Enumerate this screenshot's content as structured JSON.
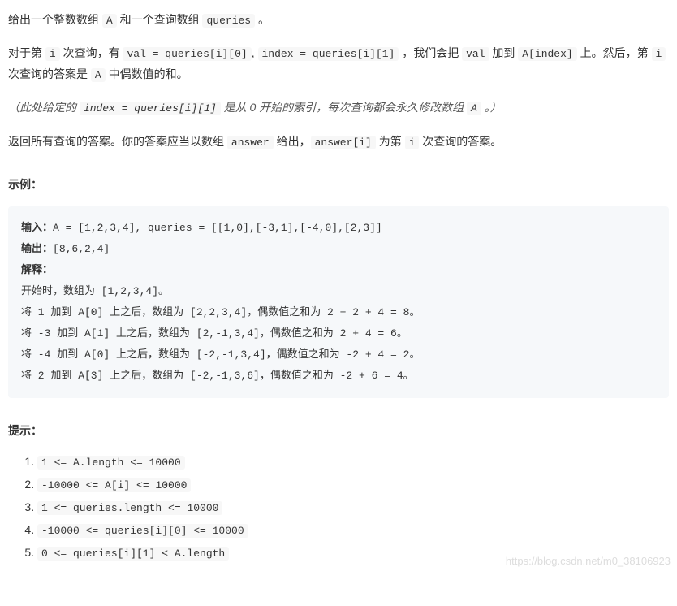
{
  "paragraphs": {
    "p1_parts": [
      "给出一个整数数组 ",
      "A",
      " 和一个查询数组 ",
      "queries",
      " 。"
    ],
    "p2_parts": [
      "对于第 ",
      "i",
      " 次查询，有 ",
      "val = queries[i][0]",
      ", ",
      "index = queries[i][1]",
      " ，我们会把 ",
      "val",
      " 加到 ",
      "A[index]",
      " 上。然后，第 ",
      "i",
      " 次查询的答案是 ",
      "A",
      " 中偶数值的和。"
    ],
    "p3_parts": [
      "（此处给定的 ",
      "index = queries[i][1]",
      " 是从 0 开始的索引，每次查询都会永久修改数组 ",
      "A",
      " 。）"
    ],
    "p4_parts": [
      "返回所有查询的答案。你的答案应当以数组 ",
      "answer",
      " 给出，",
      "answer[i]",
      " 为第 ",
      "i",
      " 次查询的答案。"
    ]
  },
  "example_title": "示例：",
  "example": {
    "input_label": "输入：",
    "input_value": "A = [1,2,3,4], queries = [[1,0],[-3,1],[-4,0],[2,3]]",
    "output_label": "输出：",
    "output_value": "[8,6,2,4]",
    "explain_label": "解释：",
    "lines": [
      "开始时，数组为 [1,2,3,4]。",
      "将 1 加到 A[0] 上之后，数组为 [2,2,3,4]，偶数值之和为 2 + 2 + 4 = 8。",
      "将 -3 加到 A[1] 上之后，数组为 [2,-1,3,4]，偶数值之和为 2 + 4 = 6。",
      "将 -4 加到 A[0] 上之后，数组为 [-2,-1,3,4]，偶数值之和为 -2 + 4 = 2。",
      "将 2 加到 A[3] 上之后，数组为 [-2,-1,3,6]，偶数值之和为 -2 + 6 = 4。"
    ]
  },
  "hints_title": "提示：",
  "hints": [
    "1 <= A.length <= 10000",
    "-10000 <= A[i] <= 10000",
    "1 <= queries.length <= 10000",
    "-10000 <= queries[i][0] <= 10000",
    "0 <= queries[i][1] < A.length"
  ],
  "watermark": "https://blog.csdn.net/m0_38106923"
}
